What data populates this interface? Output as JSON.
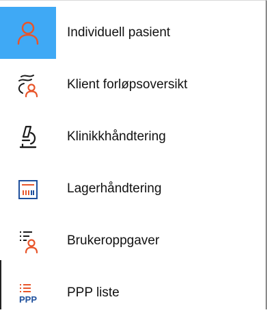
{
  "menu": {
    "items": [
      {
        "label": "Individuell pasient",
        "icon": "person-icon",
        "active": true
      },
      {
        "label": "Klient forløpsoversikt",
        "icon": "client-pathway-icon",
        "active": false
      },
      {
        "label": "Klinikkhåndtering",
        "icon": "microscope-icon",
        "active": false
      },
      {
        "label": "Lagerhåndtering",
        "icon": "inventory-chart-icon",
        "active": false
      },
      {
        "label": "Brukeroppgaver",
        "icon": "user-tasks-icon",
        "active": false
      },
      {
        "label": "PPP liste",
        "icon": "ppp-list-icon",
        "active": false
      }
    ],
    "ppp_icon_text": "PPP"
  },
  "colors": {
    "active_bg": "#3fa9f5",
    "accent_orange": "#e8552a",
    "icon_dark": "#1a1a1a",
    "icon_blue": "#1e4f9c"
  }
}
